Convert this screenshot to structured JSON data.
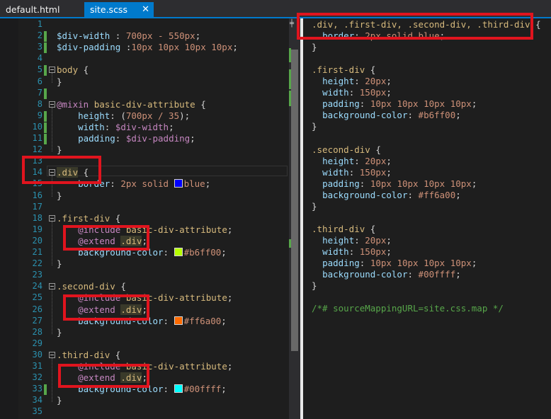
{
  "tabs": {
    "inactive_label": "default.html",
    "active_label": "site.scss",
    "close_glyph": "✕"
  },
  "scss_lines": [
    {
      "n": "1",
      "parts": []
    },
    {
      "n": "2",
      "parts": [
        [
          "c-var",
          "$div-width"
        ],
        [
          "c-pun",
          " : "
        ],
        [
          "c-val",
          "700px - 550px"
        ],
        [
          "c-pun",
          ";"
        ]
      ]
    },
    {
      "n": "3",
      "parts": [
        [
          "c-var",
          "$div-padding"
        ],
        [
          "c-pun",
          " :"
        ],
        [
          "c-val",
          "10px 10px 10px 10px"
        ],
        [
          "c-pun",
          ";"
        ]
      ]
    },
    {
      "n": "4",
      "parts": []
    },
    {
      "n": "5",
      "parts": [
        [
          "c-sel",
          "body"
        ],
        [
          "c-pun",
          " {"
        ]
      ]
    },
    {
      "n": "6",
      "parts": [
        [
          "c-pun",
          "}"
        ]
      ]
    },
    {
      "n": "7",
      "parts": []
    },
    {
      "n": "8",
      "parts": [
        [
          "c-at",
          "@mixin"
        ],
        [
          "c-pun",
          " "
        ],
        [
          "c-sel",
          "basic-div-attribute"
        ],
        [
          "c-pun",
          " {"
        ]
      ]
    },
    {
      "n": "9",
      "parts": [
        [
          "c-pun",
          "    "
        ],
        [
          "c-prop",
          "height"
        ],
        [
          "c-pun",
          ": ("
        ],
        [
          "c-val",
          "700px / 35"
        ],
        [
          "c-pun",
          ");"
        ]
      ]
    },
    {
      "n": "10",
      "parts": [
        [
          "c-pun",
          "    "
        ],
        [
          "c-prop",
          "width"
        ],
        [
          "c-pun",
          ": "
        ],
        [
          "c-at",
          "$div-width"
        ],
        [
          "c-pun",
          ";"
        ]
      ]
    },
    {
      "n": "11",
      "parts": [
        [
          "c-pun",
          "    "
        ],
        [
          "c-prop",
          "padding"
        ],
        [
          "c-pun",
          ": "
        ],
        [
          "c-at",
          "$div-padding"
        ],
        [
          "c-pun",
          ";"
        ]
      ]
    },
    {
      "n": "12",
      "parts": [
        [
          "c-pun",
          "}"
        ]
      ]
    },
    {
      "n": "13",
      "parts": []
    },
    {
      "n": "14",
      "parts": [
        [
          "c-sel hl",
          ".div"
        ],
        [
          "c-pun",
          " {"
        ]
      ]
    },
    {
      "n": "15",
      "parts": [
        [
          "c-pun",
          "    "
        ],
        [
          "c-prop",
          "border"
        ],
        [
          "c-pun",
          ": "
        ],
        [
          "c-val",
          "2px solid "
        ],
        [
          "sw",
          "#0000ff"
        ],
        [
          "c-val",
          "blue"
        ],
        [
          "c-pun",
          ";"
        ]
      ]
    },
    {
      "n": "16",
      "parts": [
        [
          "c-pun",
          "}"
        ]
      ]
    },
    {
      "n": "17",
      "parts": []
    },
    {
      "n": "18",
      "parts": [
        [
          "c-sel",
          ".first-div"
        ],
        [
          "c-pun",
          " {"
        ]
      ]
    },
    {
      "n": "19",
      "parts": [
        [
          "c-pun",
          "    "
        ],
        [
          "c-at",
          "@include"
        ],
        [
          "c-pun",
          " "
        ],
        [
          "c-sel",
          "basic-div-attribute"
        ],
        [
          "c-pun",
          ";"
        ]
      ]
    },
    {
      "n": "20",
      "parts": [
        [
          "c-pun",
          "    "
        ],
        [
          "c-at",
          "@extend"
        ],
        [
          "c-pun",
          " "
        ],
        [
          "c-sel hl",
          ".div"
        ],
        [
          "c-pun",
          ";"
        ]
      ]
    },
    {
      "n": "21",
      "parts": [
        [
          "c-pun",
          "    "
        ],
        [
          "c-prop",
          "background-color"
        ],
        [
          "c-pun",
          ": "
        ],
        [
          "sw",
          "#b6ff00"
        ],
        [
          "c-val",
          "#b6ff00"
        ],
        [
          "c-pun",
          ";"
        ]
      ]
    },
    {
      "n": "22",
      "parts": [
        [
          "c-pun",
          "}"
        ]
      ]
    },
    {
      "n": "23",
      "parts": []
    },
    {
      "n": "24",
      "parts": [
        [
          "c-sel",
          ".second-div"
        ],
        [
          "c-pun",
          " {"
        ]
      ]
    },
    {
      "n": "25",
      "parts": [
        [
          "c-pun",
          "    "
        ],
        [
          "c-at",
          "@include"
        ],
        [
          "c-pun",
          " "
        ],
        [
          "c-sel",
          "basic-div-attribute"
        ],
        [
          "c-pun",
          ";"
        ]
      ]
    },
    {
      "n": "26",
      "parts": [
        [
          "c-pun",
          "    "
        ],
        [
          "c-at",
          "@extend"
        ],
        [
          "c-pun",
          " "
        ],
        [
          "c-sel hl",
          ".div"
        ],
        [
          "c-pun",
          ";"
        ]
      ]
    },
    {
      "n": "27",
      "parts": [
        [
          "c-pun",
          "    "
        ],
        [
          "c-prop",
          "background-color"
        ],
        [
          "c-pun",
          ": "
        ],
        [
          "sw",
          "#ff6a00"
        ],
        [
          "c-val",
          "#ff6a00"
        ],
        [
          "c-pun",
          ";"
        ]
      ]
    },
    {
      "n": "28",
      "parts": [
        [
          "c-pun",
          "}"
        ]
      ]
    },
    {
      "n": "29",
      "parts": []
    },
    {
      "n": "30",
      "parts": [
        [
          "c-sel",
          ".third-div"
        ],
        [
          "c-pun",
          " {"
        ]
      ]
    },
    {
      "n": "31",
      "parts": [
        [
          "c-pun",
          "    "
        ],
        [
          "c-at",
          "@include"
        ],
        [
          "c-pun",
          " "
        ],
        [
          "c-sel",
          "basic-div-attribute"
        ],
        [
          "c-pun",
          ";"
        ]
      ]
    },
    {
      "n": "32",
      "parts": [
        [
          "c-pun",
          "    "
        ],
        [
          "c-at",
          "@extend"
        ],
        [
          "c-pun",
          " "
        ],
        [
          "c-sel hl",
          ".div"
        ],
        [
          "c-pun",
          ";"
        ]
      ]
    },
    {
      "n": "33",
      "parts": [
        [
          "c-pun",
          "    "
        ],
        [
          "c-prop",
          "background-color"
        ],
        [
          "c-pun",
          ": "
        ],
        [
          "sw",
          "#00ffff"
        ],
        [
          "c-val",
          "#00ffff"
        ],
        [
          "c-pun",
          ";"
        ]
      ]
    },
    {
      "n": "34",
      "parts": [
        [
          "c-pun",
          "}"
        ]
      ]
    },
    {
      "n": "35",
      "parts": []
    }
  ],
  "css_lines": [
    [
      [
        "c-sel",
        ".div, .first-div, .second-div, .third-div"
      ],
      [
        "c-pun",
        " {"
      ]
    ],
    [
      [
        "c-pun",
        "  "
      ],
      [
        "c-prop",
        "border"
      ],
      [
        "c-pun",
        ": "
      ],
      [
        "c-val",
        "2px solid blue"
      ],
      [
        "c-pun",
        ";"
      ]
    ],
    [
      [
        "c-pun",
        "}"
      ]
    ],
    [],
    [
      [
        "c-sel",
        ".first-div"
      ],
      [
        "c-pun",
        " {"
      ]
    ],
    [
      [
        "c-pun",
        "  "
      ],
      [
        "c-prop",
        "height"
      ],
      [
        "c-pun",
        ": "
      ],
      [
        "c-val",
        "20px"
      ],
      [
        "c-pun",
        ";"
      ]
    ],
    [
      [
        "c-pun",
        "  "
      ],
      [
        "c-prop",
        "width"
      ],
      [
        "c-pun",
        ": "
      ],
      [
        "c-val",
        "150px"
      ],
      [
        "c-pun",
        ";"
      ]
    ],
    [
      [
        "c-pun",
        "  "
      ],
      [
        "c-prop",
        "padding"
      ],
      [
        "c-pun",
        ": "
      ],
      [
        "c-val",
        "10px 10px 10px 10px"
      ],
      [
        "c-pun",
        ";"
      ]
    ],
    [
      [
        "c-pun",
        "  "
      ],
      [
        "c-prop",
        "background-color"
      ],
      [
        "c-pun",
        ": "
      ],
      [
        "c-val",
        "#b6ff00"
      ],
      [
        "c-pun",
        ";"
      ]
    ],
    [
      [
        "c-pun",
        "}"
      ]
    ],
    [],
    [
      [
        "c-sel",
        ".second-div"
      ],
      [
        "c-pun",
        " {"
      ]
    ],
    [
      [
        "c-pun",
        "  "
      ],
      [
        "c-prop",
        "height"
      ],
      [
        "c-pun",
        ": "
      ],
      [
        "c-val",
        "20px"
      ],
      [
        "c-pun",
        ";"
      ]
    ],
    [
      [
        "c-pun",
        "  "
      ],
      [
        "c-prop",
        "width"
      ],
      [
        "c-pun",
        ": "
      ],
      [
        "c-val",
        "150px"
      ],
      [
        "c-pun",
        ";"
      ]
    ],
    [
      [
        "c-pun",
        "  "
      ],
      [
        "c-prop",
        "padding"
      ],
      [
        "c-pun",
        ": "
      ],
      [
        "c-val",
        "10px 10px 10px 10px"
      ],
      [
        "c-pun",
        ";"
      ]
    ],
    [
      [
        "c-pun",
        "  "
      ],
      [
        "c-prop",
        "background-color"
      ],
      [
        "c-pun",
        ": "
      ],
      [
        "c-val",
        "#ff6a00"
      ],
      [
        "c-pun",
        ";"
      ]
    ],
    [
      [
        "c-pun",
        "}"
      ]
    ],
    [],
    [
      [
        "c-sel",
        ".third-div"
      ],
      [
        "c-pun",
        " {"
      ]
    ],
    [
      [
        "c-pun",
        "  "
      ],
      [
        "c-prop",
        "height"
      ],
      [
        "c-pun",
        ": "
      ],
      [
        "c-val",
        "20px"
      ],
      [
        "c-pun",
        ";"
      ]
    ],
    [
      [
        "c-pun",
        "  "
      ],
      [
        "c-prop",
        "width"
      ],
      [
        "c-pun",
        ": "
      ],
      [
        "c-val",
        "150px"
      ],
      [
        "c-pun",
        ";"
      ]
    ],
    [
      [
        "c-pun",
        "  "
      ],
      [
        "c-prop",
        "padding"
      ],
      [
        "c-pun",
        ": "
      ],
      [
        "c-val",
        "10px 10px 10px 10px"
      ],
      [
        "c-pun",
        ";"
      ]
    ],
    [
      [
        "c-pun",
        "  "
      ],
      [
        "c-prop",
        "background-color"
      ],
      [
        "c-pun",
        ": "
      ],
      [
        "c-val",
        "#00ffff"
      ],
      [
        "c-pun",
        ";"
      ]
    ],
    [
      [
        "c-pun",
        "}"
      ]
    ],
    [],
    [
      [
        "c-com",
        "/*# sourceMappingURL=site.css.map */"
      ]
    ]
  ],
  "colors": {
    "accent": "#007acc",
    "highlight_box": "#e0141e",
    "change_marker": "#57a64a"
  }
}
